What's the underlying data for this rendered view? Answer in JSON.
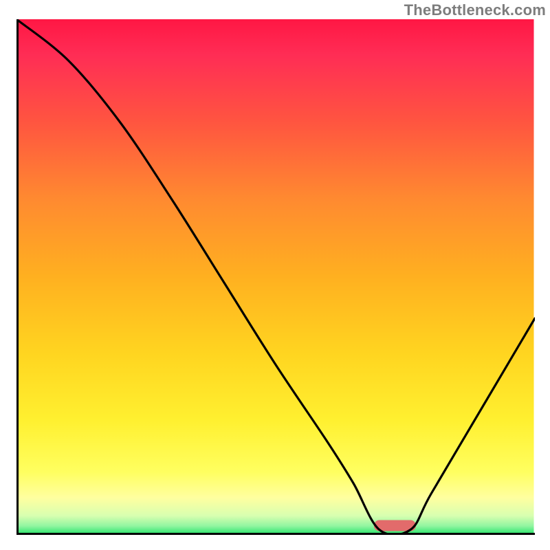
{
  "watermark": {
    "source": "TheBottleneck.com"
  },
  "chart_data": {
    "type": "line",
    "title": "",
    "xlabel": "",
    "ylabel": "",
    "xlim": [
      0,
      100
    ],
    "ylim": [
      0,
      100
    ],
    "grid": false,
    "legend": false,
    "annotations": [
      {
        "name": "optimal-marker",
        "x_range": [
          70,
          76
        ],
        "y": 1
      }
    ],
    "series": [
      {
        "name": "bottleneck-curve",
        "x": [
          0,
          10,
          20,
          30,
          40,
          50,
          60,
          65,
          70,
          76,
          80,
          90,
          100
        ],
        "values": [
          100,
          92,
          80,
          65,
          49,
          33,
          18,
          10,
          1,
          1,
          8,
          25,
          42
        ]
      }
    ],
    "background_gradient": {
      "stops": [
        {
          "offset": 0.0,
          "color": "#ff1744"
        },
        {
          "offset": 0.07,
          "color": "#ff2d55"
        },
        {
          "offset": 0.2,
          "color": "#ff5540"
        },
        {
          "offset": 0.35,
          "color": "#ff8a30"
        },
        {
          "offset": 0.5,
          "color": "#ffb020"
        },
        {
          "offset": 0.65,
          "color": "#ffd520"
        },
        {
          "offset": 0.78,
          "color": "#fff030"
        },
        {
          "offset": 0.88,
          "color": "#ffff60"
        },
        {
          "offset": 0.93,
          "color": "#ffffa0"
        },
        {
          "offset": 0.965,
          "color": "#d8ffb0"
        },
        {
          "offset": 0.985,
          "color": "#90f5a0"
        },
        {
          "offset": 1.0,
          "color": "#2ee56e"
        }
      ]
    }
  }
}
